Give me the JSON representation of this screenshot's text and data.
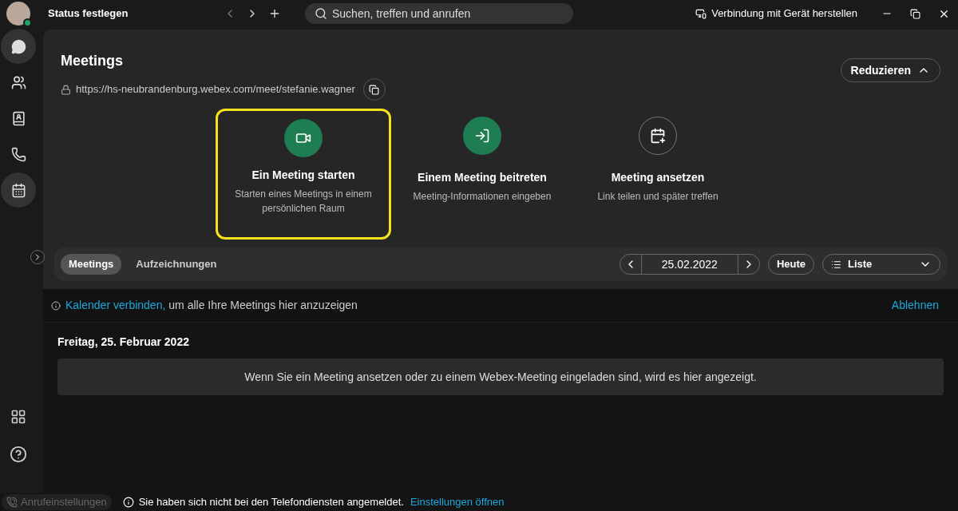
{
  "titlebar": {
    "status": "Status festlegen",
    "search": {
      "placeholder": "Suchen, treffen und anrufen"
    },
    "connect": "Verbindung mit Gerät herstellen"
  },
  "sidebar": {
    "items": [
      {
        "kind": "chat",
        "highlighted": true
      },
      {
        "kind": "teams",
        "highlighted": false
      },
      {
        "kind": "contacts",
        "highlighted": false
      },
      {
        "kind": "calls",
        "highlighted": false
      },
      {
        "kind": "calendar",
        "highlighted": true
      }
    ]
  },
  "header": {
    "title": "Meetings",
    "url": "https://hs-neubrandenburg.webex.com/meet/stefanie.wagner",
    "collapse": "Reduzieren"
  },
  "actions": [
    {
      "kind": "start",
      "title": "Ein Meeting starten",
      "subtitle": "Starten eines Meetings in einem persönlichen Raum",
      "outlined": true
    },
    {
      "kind": "join",
      "title": "Einem Meeting beitreten",
      "subtitle": "Meeting-Informationen eingeben",
      "outlined": false
    },
    {
      "kind": "schedule",
      "title": "Meeting ansetzen",
      "subtitle": "Link teilen und später treffen",
      "outlined": false
    }
  ],
  "tabs": [
    {
      "label": "Meetings",
      "selected": true
    },
    {
      "label": "Aufzeichnungen",
      "selected": false
    }
  ],
  "date": "25.02.2022",
  "today": "Heute",
  "view": "Liste",
  "notice": {
    "link": "Kalender verbinden,",
    "text": "um alle Ihre Meetings hier anzuzeigen",
    "dismiss": "Ablehnen"
  },
  "day": "Freitag, 25. Februar 2022",
  "empty": "Wenn Sie ein Meeting ansetzen oder zu einem Webex-Meeting eingeladen sind, wird es hier angezeigt.",
  "statusbar": {
    "call_settings": "Anrufeinstellungen",
    "message": "Sie haben sich nicht bei den Telefondiensten angemeldet.",
    "link": "Einstellungen öffnen"
  }
}
